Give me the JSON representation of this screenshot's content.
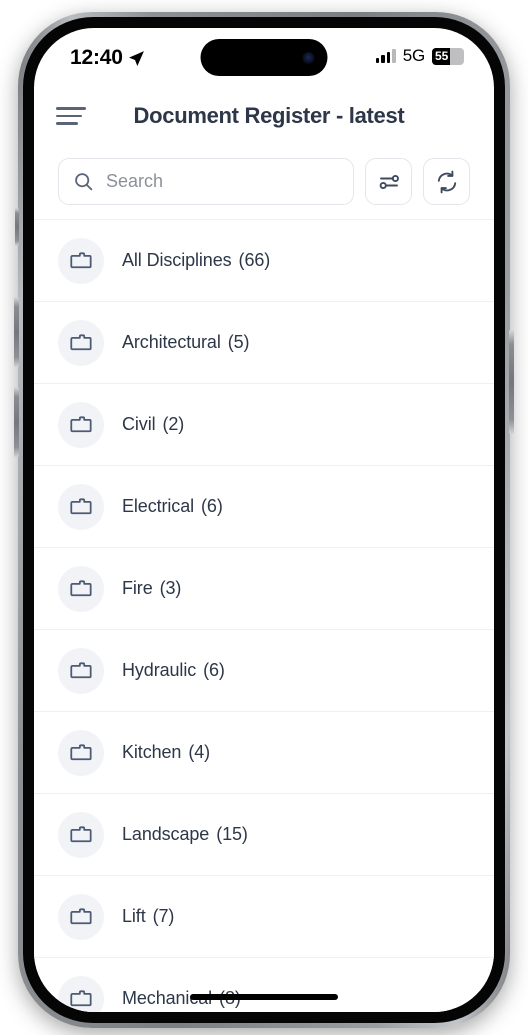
{
  "status_bar": {
    "time": "12:40",
    "location_icon": "location-arrow-icon",
    "network": "5G",
    "battery_percent": "55",
    "battery_level": 55,
    "signal_icon": "signal-bars-icon"
  },
  "header": {
    "menu_icon": "hamburger-menu-icon",
    "title": "Document Register - latest"
  },
  "search": {
    "icon": "search-icon",
    "placeholder": "Search",
    "value": "",
    "filter_icon": "filter-sliders-icon",
    "refresh_icon": "refresh-sync-icon"
  },
  "list": {
    "folder_icon": "folder-icon",
    "items": [
      {
        "label": "All Disciplines",
        "count": "(66)"
      },
      {
        "label": "Architectural",
        "count": "(5)"
      },
      {
        "label": "Civil",
        "count": "(2)"
      },
      {
        "label": "Electrical",
        "count": "(6)"
      },
      {
        "label": "Fire",
        "count": "(3)"
      },
      {
        "label": "Hydraulic",
        "count": "(6)"
      },
      {
        "label": "Kitchen",
        "count": "(4)"
      },
      {
        "label": "Landscape",
        "count": "(15)"
      },
      {
        "label": "Lift",
        "count": "(7)"
      },
      {
        "label": "Mechanical",
        "count": "(8)"
      }
    ]
  },
  "colors": {
    "text_primary": "#2d3748",
    "icon_slate": "#5a6478",
    "badge_bg": "#f1f3f7",
    "divider": "#eef0f3",
    "border": "#e3e6ea",
    "placeholder": "#8b9099"
  }
}
